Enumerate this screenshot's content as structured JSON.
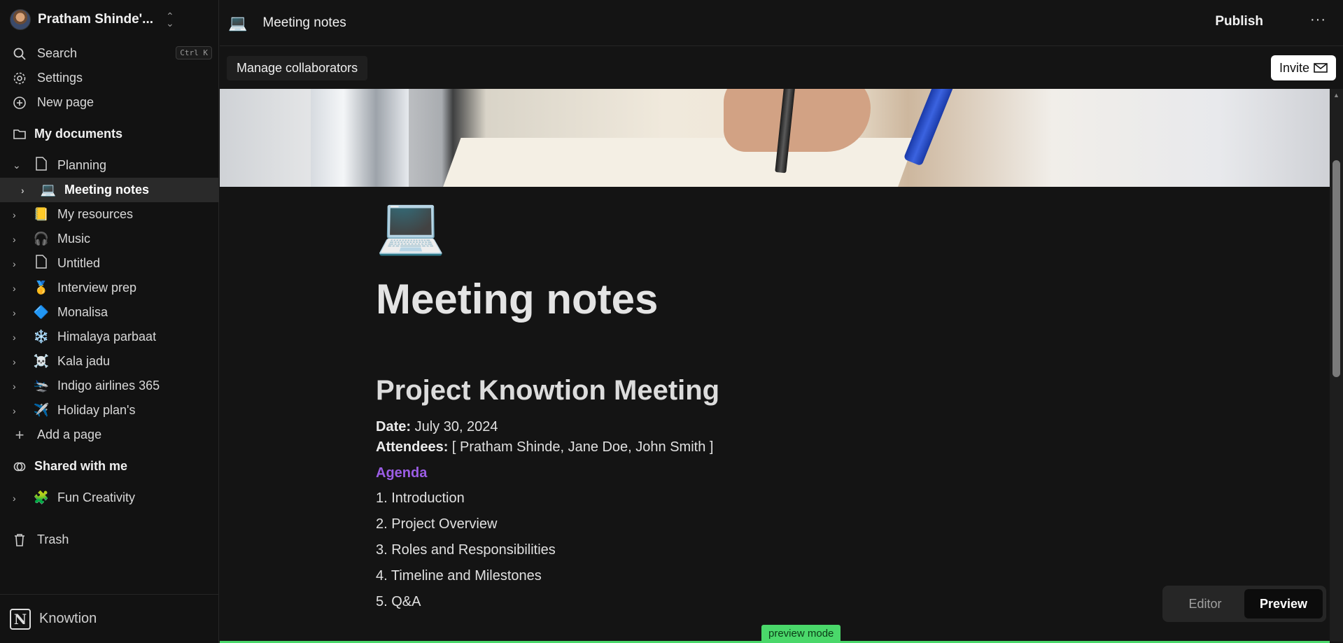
{
  "workspace": {
    "name": "Pratham Shinde'..."
  },
  "sidebar": {
    "search_label": "Search",
    "search_shortcut": "Ctrl K",
    "settings_label": "Settings",
    "new_page_label": "New page",
    "my_documents_label": "My documents",
    "pages": [
      {
        "label": "Planning",
        "emoji": "📄"
      },
      {
        "label": "Meeting notes",
        "emoji": "💻"
      },
      {
        "label": "My resources",
        "emoji": "📒"
      },
      {
        "label": "Music",
        "emoji": "🎧"
      },
      {
        "label": "Untitled",
        "emoji": "📄"
      },
      {
        "label": "Interview prep",
        "emoji": "🥇"
      },
      {
        "label": "Monalisa",
        "emoji": "🔷"
      },
      {
        "label": "Himalaya parbaat",
        "emoji": "❄️"
      },
      {
        "label": "Kala jadu",
        "emoji": "☠️"
      },
      {
        "label": "Indigo airlines 365",
        "emoji": "🛬"
      },
      {
        "label": "Holiday plan's",
        "emoji": "✈️"
      }
    ],
    "add_page_label": "Add a page",
    "shared_label": "Shared with me",
    "shared_pages": [
      {
        "label": "Fun Creativity",
        "emoji": "🧩"
      }
    ],
    "trash_label": "Trash",
    "brand": "Knowtion",
    "logo_letter": "N"
  },
  "header": {
    "page_emoji": "💻",
    "page_title": "Meeting notes",
    "publish_label": "Publish",
    "more_label": "···",
    "manage_collaborators_label": "Manage collaborators",
    "invite_label": "Invite"
  },
  "document": {
    "icon": "💻",
    "title": "Meeting notes",
    "heading": "Project Knowtion Meeting",
    "date_label": "Date:",
    "date_value": "July 30, 2024",
    "attendees_label": "Attendees:",
    "attendees_value": "[ Pratham Shinde, Jane Doe, John Smith ]",
    "agenda_label": "Agenda",
    "agenda_items": [
      "1.  Introduction",
      "2.  Project Overview",
      "3.  Roles and Responsibilities",
      "4.  Timeline and Milestones",
      "5.  Q&A"
    ]
  },
  "mode": {
    "editor_label": "Editor",
    "preview_label": "Preview",
    "active": "Preview",
    "badge": "preview mode"
  },
  "colors": {
    "accent_purple": "#9b5de5",
    "badge_green": "#4ad86a"
  }
}
